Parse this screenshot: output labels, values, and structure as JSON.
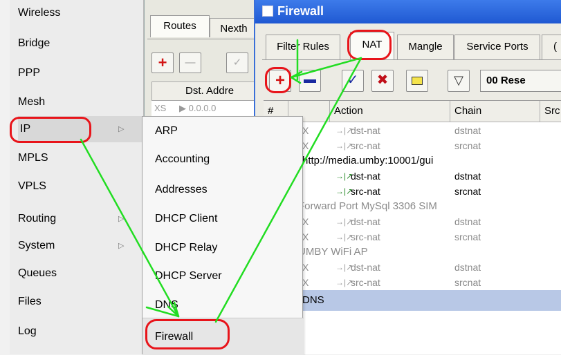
{
  "main_menu": {
    "items": [
      {
        "label": "Wireless",
        "has_submenu": false
      },
      {
        "label": "Bridge",
        "has_submenu": false
      },
      {
        "label": "PPP",
        "has_submenu": false
      },
      {
        "label": "Mesh",
        "has_submenu": false
      },
      {
        "label": "IP",
        "has_submenu": true
      },
      {
        "label": "MPLS",
        "has_submenu": false
      },
      {
        "label": "VPLS",
        "has_submenu": false
      },
      {
        "label": "Routing",
        "has_submenu": true
      },
      {
        "label": "System",
        "has_submenu": true
      },
      {
        "label": "Queues",
        "has_submenu": false
      },
      {
        "label": "Files",
        "has_submenu": false
      },
      {
        "label": "Log",
        "has_submenu": false
      }
    ]
  },
  "ip_submenu": {
    "items": [
      "ARP",
      "Accounting",
      "Addresses",
      "DHCP Client",
      "DHCP Relay",
      "DHCP Server",
      "DNS",
      "Firewall"
    ]
  },
  "routes_window": {
    "tabs": [
      "Routes",
      "Nexth"
    ],
    "column_header": "Dst. Addre",
    "row_flag": "XS",
    "row_value": "▶ 0.0.0.0"
  },
  "firewall": {
    "title": "Firewall",
    "tabs": [
      "Filter Rules",
      "NAT",
      "Mangle",
      "Service Ports",
      "("
    ],
    "reset_label": "00 Rese",
    "columns": [
      "#",
      "",
      "Action",
      "Chain",
      "Src"
    ],
    "rows": [
      {
        "type": "rule",
        "flag": "X",
        "action": "dst-nat",
        "chain": "dstnat",
        "disabled": true
      },
      {
        "type": "rule",
        "flag": "X",
        "action": "src-nat",
        "chain": "srcnat",
        "disabled": true
      },
      {
        "type": "comment",
        "text": "http://media.umby:10001/gui",
        "disabled": false
      },
      {
        "type": "rule",
        "flag": "",
        "action": "dst-nat",
        "chain": "dstnat",
        "disabled": false
      },
      {
        "type": "rule",
        "flag": "",
        "action": "src-nat",
        "chain": "srcnat",
        "disabled": false
      },
      {
        "type": "comment",
        "text": "Forward Port MySql 3306 SIM",
        "disabled": true
      },
      {
        "type": "rule",
        "flag": "X",
        "action": "dst-nat",
        "chain": "dstnat",
        "disabled": true
      },
      {
        "type": "rule",
        "flag": "X",
        "action": "src-nat",
        "chain": "srcnat",
        "disabled": true
      },
      {
        "type": "comment",
        "text": "UMBY WiFi AP",
        "disabled": true
      },
      {
        "type": "rule",
        "flag": "X",
        "action": "dst-nat",
        "chain": "dstnat",
        "disabled": true
      },
      {
        "type": "rule",
        "flag": "X",
        "action": "src-nat",
        "chain": "srcnat",
        "disabled": true
      },
      {
        "type": "comment",
        "text": "DNS",
        "disabled": false
      }
    ]
  },
  "colors": {
    "highlight_ring": "#e8141a",
    "annotation_arrow": "#22dd22",
    "titlebar": "#2a63dc",
    "selected_row": "#b8c8e6"
  }
}
